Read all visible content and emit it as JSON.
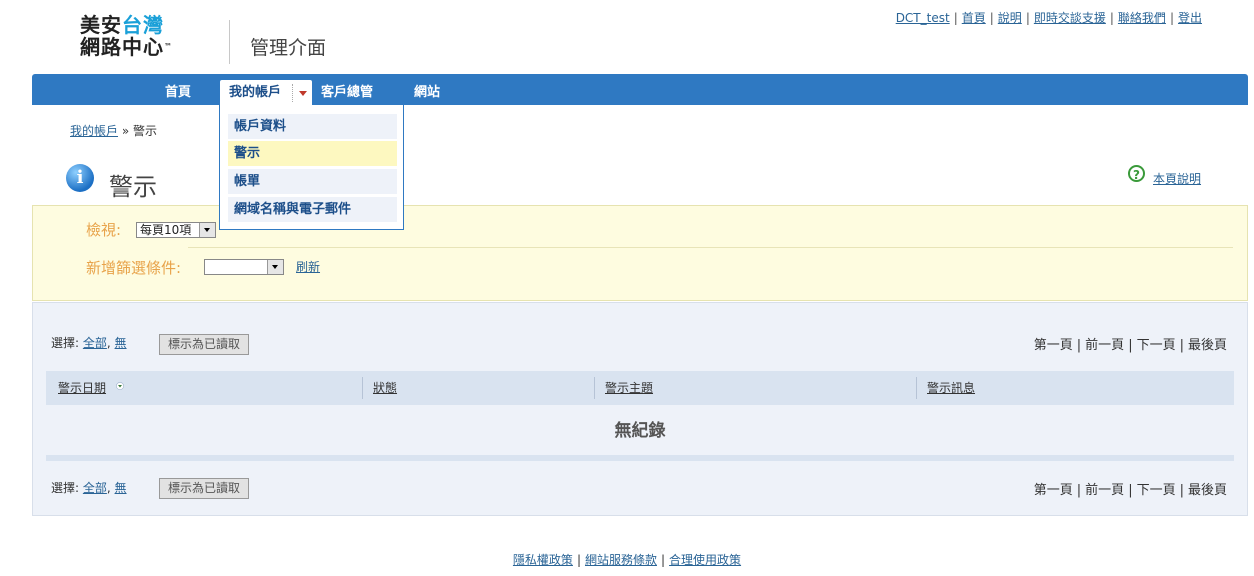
{
  "brand": {
    "line1_black": "美安",
    "line1_cyan": "台灣",
    "line2": "網路中心",
    "tm": "™"
  },
  "app_title": "管理介面",
  "top_links": {
    "user": "DCT_test",
    "home": "首頁",
    "help": "說明",
    "chat": "即時交談支援",
    "contact": "聯絡我們",
    "logout": "登出"
  },
  "nav": {
    "home": "首頁",
    "my_account": "我的帳戶",
    "customers": "客戶總管",
    "sites": "網站"
  },
  "dropdown": {
    "items": [
      "帳戶資料",
      "警示",
      "帳單",
      "網域名稱與電子郵件"
    ]
  },
  "breadcrumb": {
    "parent": "我的帳戶",
    "separator": "»",
    "current": "警示"
  },
  "page": {
    "title": "警示",
    "help_link": "本頁說明"
  },
  "filter": {
    "view_label": "檢視:",
    "view_value": "每頁10項",
    "add_filter_label": "新增篩選條件:",
    "add_filter_value": "",
    "refresh": "刷新"
  },
  "list": {
    "select_label": "選擇:",
    "select_all": "全部",
    "select_none": "無",
    "comma": ",",
    "mark_read": "標示為已讀取",
    "pager": {
      "first": "第一頁",
      "prev": "前一頁",
      "next": "下一頁",
      "last": "最後頁"
    },
    "columns": [
      "警示日期",
      "狀態",
      "警示主題",
      "警示訊息"
    ],
    "empty": "無紀錄"
  },
  "footer": {
    "privacy": "隱私權政策",
    "terms": "網站服務條款",
    "aup": "合理使用政策"
  },
  "colors": {
    "nav_blue": "#2f79c2",
    "filter_bg": "#fefce0",
    "filter_label": "#e8a34a",
    "list_bg": "#eef2f9",
    "link": "#2a6496"
  }
}
